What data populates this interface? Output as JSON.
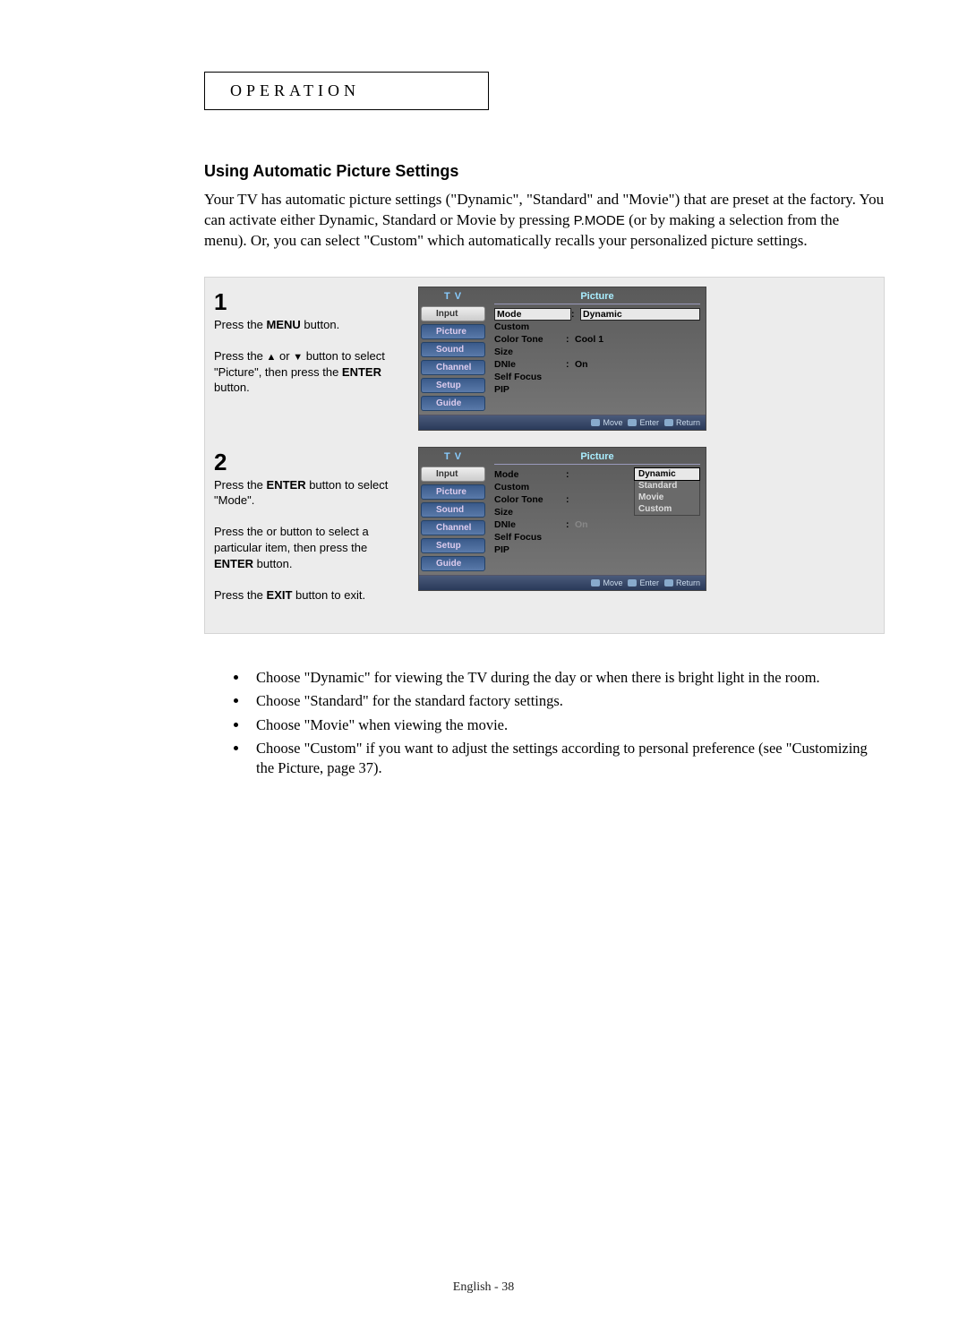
{
  "section_label": "OPERATION",
  "heading": "Using Automatic Picture Settings",
  "intro": "Your TV has automatic picture settings (\"Dynamic\", \"Standard\" and \"Movie\") that are preset at the factory.  You can activate either Dynamic, Standard or Movie by pressing ",
  "intro_pmode": "P.MODE",
  "intro_after": " (or by making a selection from the menu). Or, you can select \"Custom\" which automatically recalls your personalized picture settings.",
  "step1": {
    "num": "1",
    "l1a": "Press the ",
    "l1b": "MENU",
    "l1c": " button.",
    "l2a": "Press the ",
    "l2b": " or ",
    "l2c": " button to select \"Picture\", then press the ",
    "l2d": "ENTER",
    "l2e": " button."
  },
  "step2": {
    "num": "2",
    "l1a": "Press the ",
    "l1b": "ENTER",
    "l1c": " button to select \"Mode\".",
    "l2a": "Press the    or    button to select a particular item, then press the ",
    "l2b": "ENTER",
    "l2c": " button.",
    "l3a": "Press the ",
    "l3b": "EXIT",
    "l3c": " button to exit."
  },
  "osd": {
    "tv": "T V",
    "title": "Picture",
    "tabs": [
      "Input",
      "Picture",
      "Sound",
      "Channel",
      "Setup",
      "Guide"
    ],
    "rows": {
      "mode": "Mode",
      "custom": "Custom",
      "colortone": "Color Tone",
      "size": "Size",
      "dnie": "DNIe",
      "selffocus": "Self Focus",
      "pip": "PIP"
    },
    "vals": {
      "dynamic": "Dynamic",
      "cool1": "Cool 1",
      "on": "On"
    },
    "options": [
      "Dynamic",
      "Standard",
      "Movie",
      "Custom"
    ],
    "footer": {
      "move": "Move",
      "enter": "Enter",
      "return": "Return"
    }
  },
  "bullets": [
    "Choose \"Dynamic\" for viewing the TV during the day or when there is bright light in the room.",
    "Choose \"Standard\" for the standard factory settings.",
    "Choose \"Movie\" when viewing the movie.",
    "Choose \"Custom\" if you want to adjust the settings according to personal preference (see \"Customizing the Picture, page 37)."
  ],
  "pagenum": "English - 38"
}
